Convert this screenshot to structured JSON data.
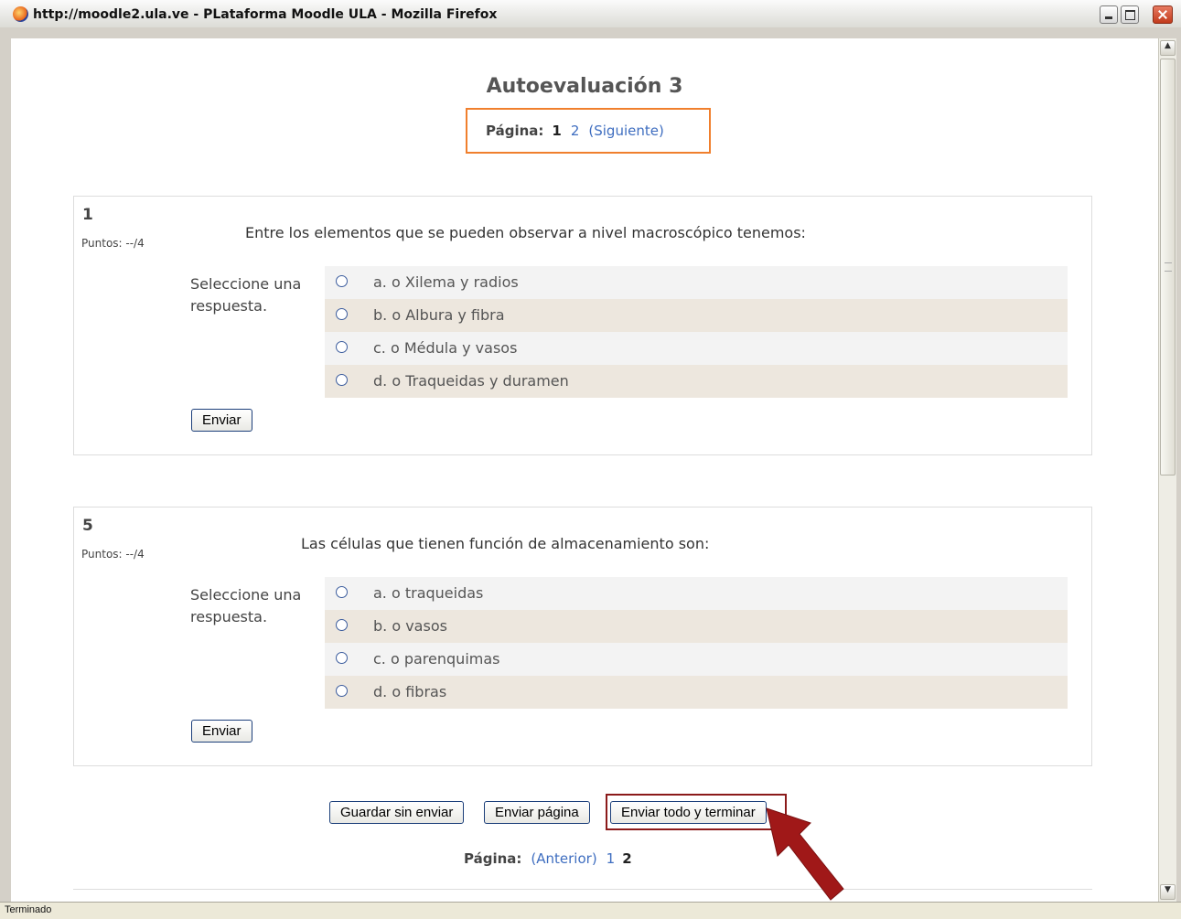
{
  "window": {
    "title": "http://moodle2.ula.ve - PLataforma Moodle ULA - Mozilla Firefox",
    "status": "Terminado"
  },
  "page": {
    "title": "Autoevaluación 3",
    "pager_top": {
      "label": "Página:",
      "current": "1",
      "next_page": "2",
      "next_link": "(Siguiente)"
    },
    "pager_bottom": {
      "label": "Página:",
      "prev_link": "(Anterior)",
      "prev_page": "1",
      "current": "2"
    }
  },
  "questions": [
    {
      "number": "1",
      "points": "Puntos: --/4",
      "text": "Entre los elementos que se pueden observar a nivel macroscópico tenemos:",
      "prompt": "Seleccione una respuesta.",
      "answers": [
        "a. o Xilema y radios",
        "b. o Albura y fibra",
        "c. o Médula y vasos",
        "d. o Traqueidas y duramen"
      ],
      "submit_label": "Enviar"
    },
    {
      "number": "5",
      "points": "Puntos: --/4",
      "text": "Las células que tienen función de almacenamiento son:",
      "prompt": "Seleccione una respuesta.",
      "answers": [
        "a. o traqueidas",
        "b. o vasos",
        "c. o parenquimas",
        "d. o fibras"
      ],
      "submit_label": "Enviar"
    }
  ],
  "actions": {
    "save": "Guardar sin enviar",
    "submit_page": "Enviar página",
    "submit_all": "Enviar todo y terminar"
  },
  "colors": {
    "highlight_box": "#f07f2d",
    "arrow": "#a01818",
    "link": "#3f6ec0"
  }
}
